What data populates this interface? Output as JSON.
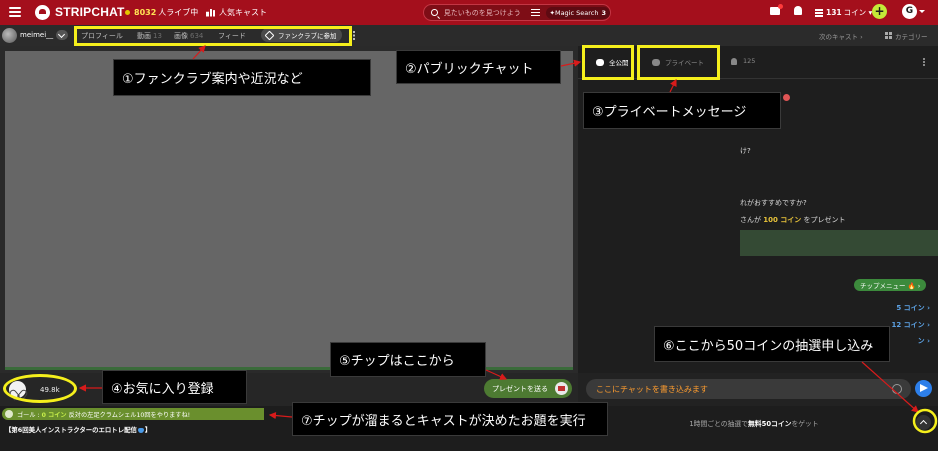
{
  "topbar": {
    "brand": "STRIPCHAT",
    "online_count": "8032",
    "online_label": "人ライブ中",
    "popular_label": "人気キャスト",
    "search_placeholder": "見たいものを見つけよう",
    "magic_search_label": "Magic Search",
    "magic_search_count": "3",
    "coin_amount": "131",
    "coin_label": "コイン",
    "add_button": "+",
    "user_initial": "G"
  },
  "subbar": {
    "model_name": "meimei__",
    "nav": {
      "profile": "プロフィール",
      "videos": "動画",
      "videos_count": "13",
      "images": "画像",
      "images_count": "634",
      "feed": "フィード"
    },
    "fanclub_button": "ファンクラブに参加",
    "next_cast": "次のキャスト ›",
    "categories": "カテゴリー"
  },
  "chat": {
    "tab_public": "全公開",
    "tab_private": "プライベート",
    "viewer_count": "125",
    "messages": [
      {
        "text": "け?"
      },
      {
        "text": "れがおすすめですか?"
      }
    ],
    "tip_message": {
      "prefix": "さんが",
      "amount": "100 コイン",
      "suffix": "をプレゼント"
    },
    "tip_menu_button": "チップメニュー 🔥 ›",
    "tip_items": [
      "5 コイン ›",
      "12 コイン ›",
      "ン ›"
    ],
    "input_placeholder": "ここにチャットを書き込みます"
  },
  "video_bottom": {
    "favorite_count": "49.8k",
    "gift_button": "プレゼントを送る"
  },
  "goal": {
    "label": "ゴール :",
    "amount": "0 コイン",
    "text": "反対の左足クラムシェル10回をやりますね!"
  },
  "stream_title": {
    "before": "【第6回美人インストラクターのエロトレ配信",
    "after": "】"
  },
  "lottery": {
    "before": "1時間ごとの抽選で",
    "highlight": "無料50コイン",
    "after": "をゲット"
  },
  "annotations": {
    "a1": "①ファンクラブ案内や近況など",
    "a2": "②パブリックチャット",
    "a3": "③プライベートメッセージ",
    "a4": "④お気に入り登録",
    "a5": "⑤チップはここから",
    "a6": "⑥ここから50コインの抽選申し込み",
    "a7": "⑦チップが溜まるとキャストが決めたお題を実行"
  },
  "colors": {
    "topbar": "#a40f1c",
    "highlight": "#f5ef1c",
    "accent_green": "#6a8f2d",
    "send_blue": "#2d7fea",
    "placeholder_orange": "#ff9d2f",
    "arrow_red": "#d81b1b"
  }
}
